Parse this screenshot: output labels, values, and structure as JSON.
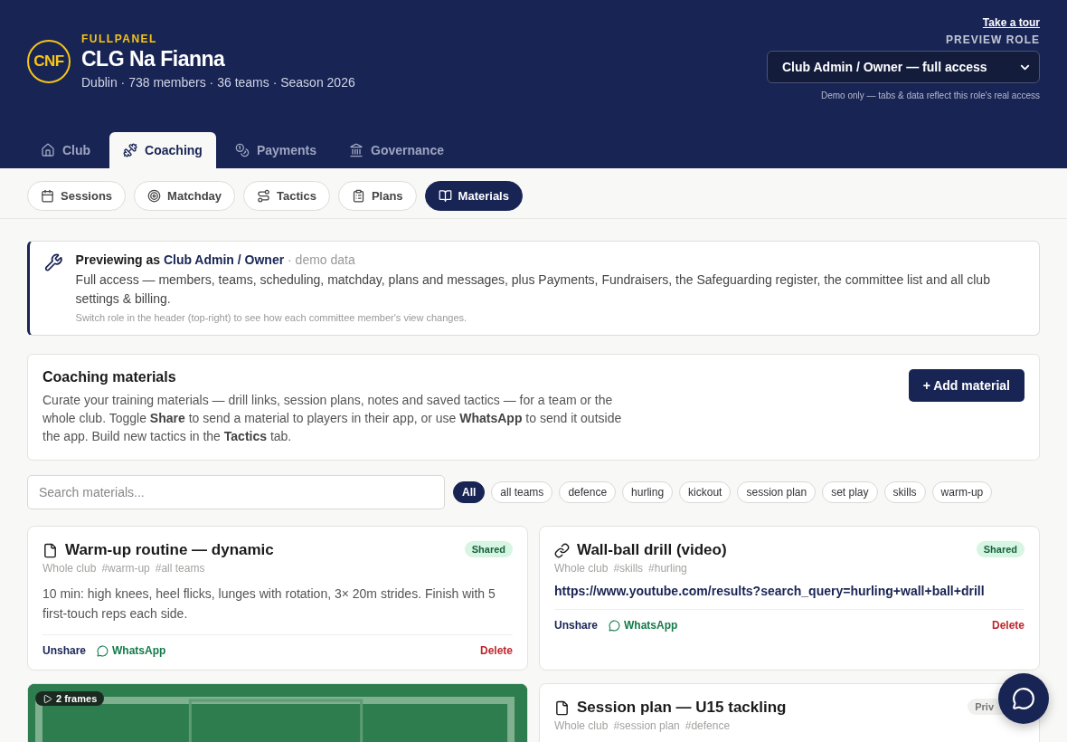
{
  "brand": {
    "logo": "CNF",
    "app": "FULLPANEL",
    "club": "CLG Na Fianna",
    "meta": "Dublin · 738 members · 36 teams · Season 2026"
  },
  "header_right": {
    "tour_link": "Take a tour",
    "role_label": "PREVIEW ROLE",
    "role_value": "Club Admin / Owner — full access",
    "note": "Demo only — tabs & data reflect this role's real access"
  },
  "tabs": [
    {
      "label": "Club",
      "selected": false
    },
    {
      "label": "Coaching",
      "selected": true
    },
    {
      "label": "Payments",
      "selected": false
    },
    {
      "label": "Governance",
      "selected": false
    }
  ],
  "subtabs": [
    {
      "label": "Sessions",
      "selected": false
    },
    {
      "label": "Matchday",
      "selected": false
    },
    {
      "label": "Tactics",
      "selected": false
    },
    {
      "label": "Plans",
      "selected": false
    },
    {
      "label": "Materials",
      "selected": true
    }
  ],
  "preview_notice": {
    "title": "**Previewing as** *Club Admin / Owner* · demo data",
    "body": "Full access — members, teams, scheduling, matchday, plans and messages, plus Payments, Fundraisers, the Safeguarding register, the committee list and all club settings & billing.",
    "hint": "Switch role in the header (top-right) to see how each committee member's view changes."
  },
  "materials_intro": {
    "title": "Coaching materials",
    "body": "Curate your training materials — drill links, session plans, notes and saved tactics — for a team or the whole club. Toggle **Share** to send a material to players in their app, or use **WhatsApp** to send it outside the app. Build new tactics in the **Tactics** tab.",
    "add_button": "+ Add material"
  },
  "search": {
    "placeholder": "Search materials..."
  },
  "filters": [
    {
      "label": "All",
      "selected": true
    },
    {
      "label": "all teams",
      "selected": false
    },
    {
      "label": "defence",
      "selected": false
    },
    {
      "label": "hurling",
      "selected": false
    },
    {
      "label": "kickout",
      "selected": false
    },
    {
      "label": "session plan",
      "selected": false
    },
    {
      "label": "set play",
      "selected": false
    },
    {
      "label": "skills",
      "selected": false
    },
    {
      "label": "warm-up",
      "selected": false
    }
  ],
  "materials": [
    {
      "kind": "note",
      "title": "Warm-up routine — dynamic",
      "status": {
        "kind": "shared",
        "label": "Shared"
      },
      "scope": "Whole club",
      "tags": [
        "#warm-up",
        "#all teams"
      ],
      "body": "10 min: high knees, heel flicks, lunges with rotation, 3× 20m strides. Finish with 5 first-touch reps each side.",
      "actions": {
        "share": "Unshare",
        "whatsapp": "WhatsApp",
        "delete": "Delete"
      }
    },
    {
      "kind": "link",
      "title": "Wall-ball drill (video)",
      "status": {
        "kind": "shared",
        "label": "Shared"
      },
      "scope": "Whole club",
      "tags": [
        "#skills",
        "#hurling"
      ],
      "url": "https://www.youtube.com/results?search_query=hurling+wall+ball+drill",
      "actions": {
        "share": "Unshare",
        "whatsapp": "WhatsApp",
        "delete": "Delete"
      }
    },
    {
      "kind": "tactic",
      "frames": "2 frames"
    },
    {
      "kind": "note",
      "title": "Session plan — U15 tackling",
      "status": {
        "kind": "private",
        "label": "Priv"
      },
      "scope": "Whole club",
      "tags": [
        "#session plan",
        "#defence"
      ]
    }
  ]
}
